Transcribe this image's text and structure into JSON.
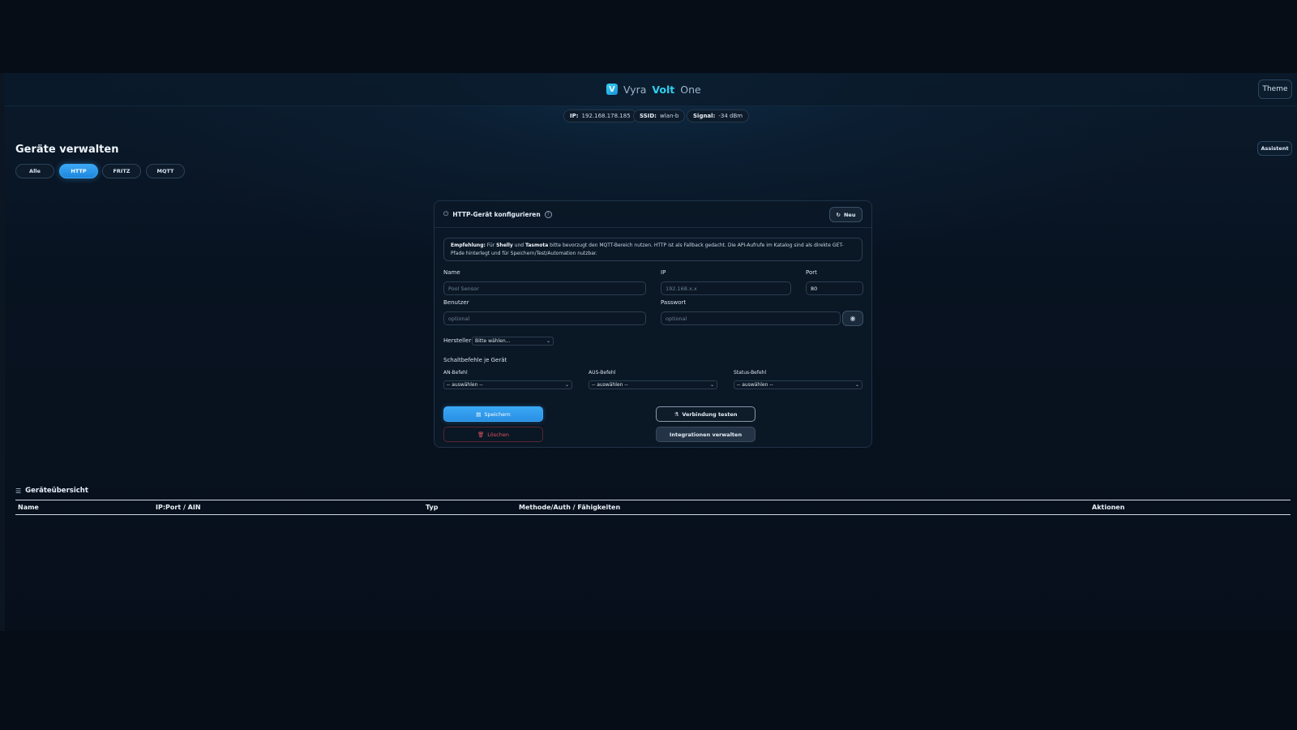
{
  "header": {
    "brand_part1": "Vyra",
    "brand_part2": "Volt",
    "brand_part3": "One",
    "logo_letter": "V",
    "theme_label": "Theme"
  },
  "status": {
    "ip_label": "IP:",
    "ip_value": "192.168.178.185",
    "ssid_label": "SSID:",
    "ssid_value": "wlan-b",
    "signal_label": "Signal:",
    "signal_value": "-34 dBm"
  },
  "page": {
    "title": "Geräte verwalten",
    "assistant_label": "Assistent"
  },
  "tabs": [
    {
      "label": "Alle",
      "active": false
    },
    {
      "label": "HTTP",
      "active": true
    },
    {
      "label": "FRITZ",
      "active": false
    },
    {
      "label": "MQTT",
      "active": false
    }
  ],
  "panel": {
    "title": "HTTP-Gerät konfigurieren",
    "new_label": "Neu",
    "notice_bold1": "Empfehlung:",
    "notice_t1": " Für ",
    "notice_bold2": "Shelly",
    "notice_t2": " und ",
    "notice_bold3": "Tasmota",
    "notice_t3": " bitte bevorzugt den MQTT-Bereich nutzen. HTTP ist als Fallback gedacht. Die API-Aufrufe im Katalog sind als direkte GET-Pfade hinterlegt und für Speichern/Test/Automation nutzbar.",
    "name_label": "Name",
    "name_placeholder": "Pool Sensor",
    "ip_label": "IP",
    "ip_placeholder": "192.168.x.x",
    "port_label": "Port",
    "port_value": "80",
    "user_label": "Benutzer",
    "user_placeholder": "optional",
    "password_label": "Passwort",
    "password_placeholder": "optional",
    "manufacturer_label": "Hersteller",
    "manufacturer_value": "Bitte wählen...",
    "commands_heading": "Schaltbefehle je Gerät",
    "on_label": "AN-Befehl",
    "on_value": "-- auswählen --",
    "off_label": "AUS-Befehl",
    "off_value": "-- auswählen --",
    "status_label": "Status-Befehl",
    "status_value": "-- auswählen --",
    "save_label": "Speichern",
    "delete_label": "Löschen",
    "test_label": "Verbindung testen",
    "integrations_label": "Integrationen verwalten"
  },
  "overview": {
    "title": "Geräteübersicht",
    "columns": [
      "Name",
      "IP:Port / AIN",
      "Typ",
      "Methode/Auth / Fähigkeiten",
      "Aktionen"
    ]
  },
  "colors": {
    "accent": "#3aa8f5",
    "brand_cyan": "#2fd0ef",
    "danger": "#e0525f",
    "background": "#070d16"
  }
}
